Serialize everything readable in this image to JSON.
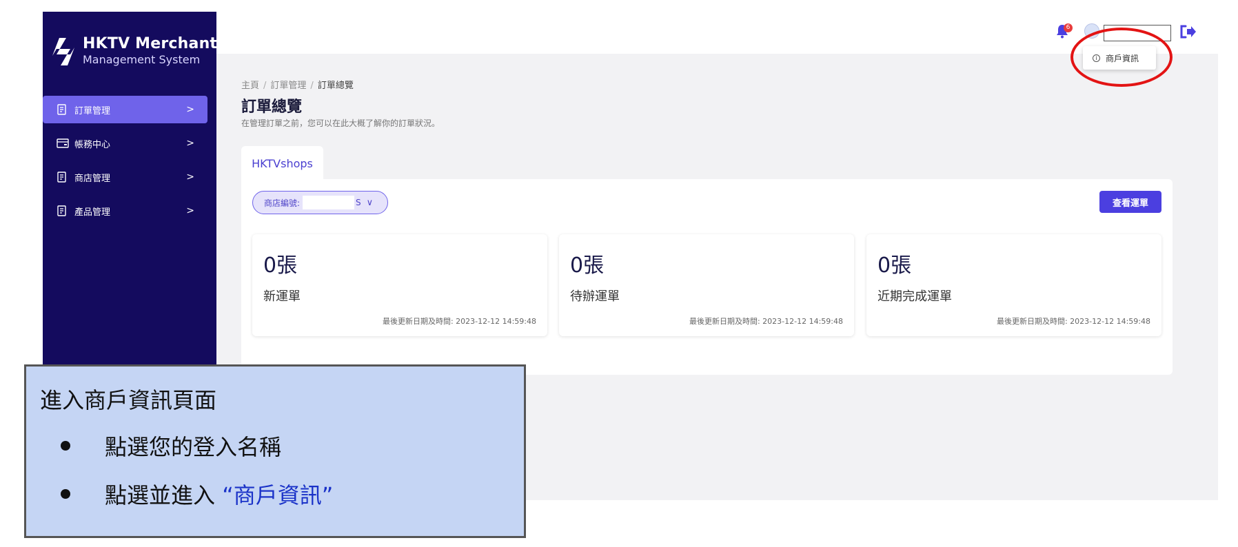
{
  "brand": {
    "title": "HKTV Merchant",
    "subtitle": "Management System"
  },
  "sidebar": {
    "items": [
      {
        "label": "訂單管理",
        "active": true
      },
      {
        "label": "帳務中心",
        "active": false
      },
      {
        "label": "商店管理",
        "active": false
      },
      {
        "label": "產品管理",
        "active": false
      }
    ],
    "chevron": ">"
  },
  "header": {
    "notification_count": "6",
    "user_menu": {
      "item_label": "商戶資訊",
      "item_icon": "info-icon"
    }
  },
  "breadcrumb": {
    "items": [
      "主頁",
      "訂單管理",
      "訂單總覽"
    ],
    "separator": "/"
  },
  "page": {
    "title": "訂單總覽",
    "description": "在管理訂單之前，您可以在此大概了解你的訂單狀況。"
  },
  "tabs": [
    {
      "label": "HKTVshops",
      "active": true
    }
  ],
  "shop_select": {
    "label": "商店編號:",
    "value_tail": "S"
  },
  "view_waybill_button": "查看運單",
  "cards": [
    {
      "count": "0張",
      "label": "新運單",
      "updated": "最後更新日期及時間: 2023-12-12 14:59:48"
    },
    {
      "count": "0張",
      "label": "待辦運單",
      "updated": "最後更新日期及時間: 2023-12-12 14:59:48"
    },
    {
      "count": "0張",
      "label": "近期完成運單",
      "updated": "最後更新日期及時間: 2023-12-12 14:59:48"
    }
  ],
  "callout": {
    "title": "進入商戶資訊頁面",
    "bullets": [
      {
        "text": "點選您的登入名稱"
      },
      {
        "text": "點選並進入 ",
        "highlight": "“商戶資訊”"
      }
    ]
  },
  "colors": {
    "sidebar_bg": "#140b5e",
    "accent": "#4b3fe0",
    "active_nav": "#6f63ea",
    "callout_bg": "#c5d5f4",
    "highlight_circle": "#e31414"
  }
}
